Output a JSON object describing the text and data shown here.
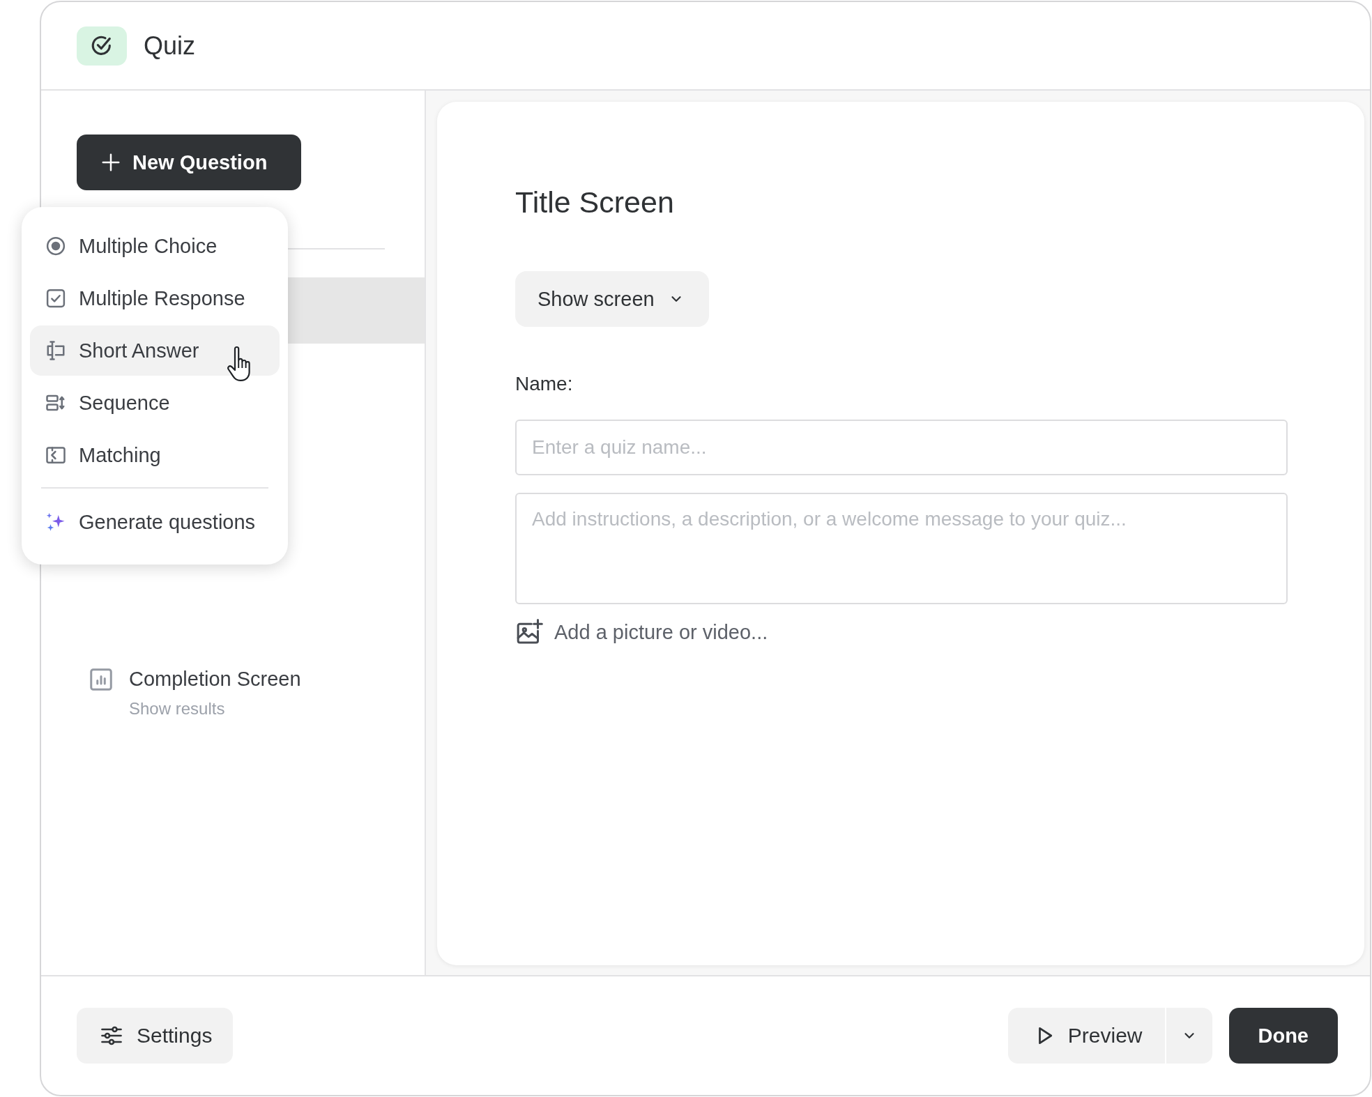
{
  "window": {
    "title": "Quiz"
  },
  "sidebar": {
    "new_question_button": "New Question",
    "items": [
      {
        "kind": "completion",
        "title": "Completion Screen",
        "subtitle": "Show results",
        "selected": false
      }
    ]
  },
  "question_menu": {
    "items": [
      {
        "kind": "multiple-choice",
        "label": "Multiple Choice",
        "highlighted": false
      },
      {
        "kind": "multiple-response",
        "label": "Multiple Response",
        "highlighted": false
      },
      {
        "kind": "short-answer",
        "label": "Short Answer",
        "highlighted": true
      },
      {
        "kind": "sequence",
        "label": "Sequence",
        "highlighted": false
      },
      {
        "kind": "matching",
        "label": "Matching",
        "highlighted": false
      },
      {
        "kind": "generate",
        "label": "Generate questions",
        "highlighted": false
      }
    ]
  },
  "editor": {
    "heading": "Title Screen",
    "visibility_dropdown": "Show screen",
    "name_label": "Name:",
    "name_field": {
      "placeholder": "Enter a quiz name..."
    },
    "description_field": {
      "placeholder": "Add instructions, a description, or a welcome message to your quiz..."
    },
    "media_link": "Add a picture or video..."
  },
  "footer": {
    "settings_button": "Settings",
    "preview_button": "Preview",
    "done_button": "Done"
  }
}
